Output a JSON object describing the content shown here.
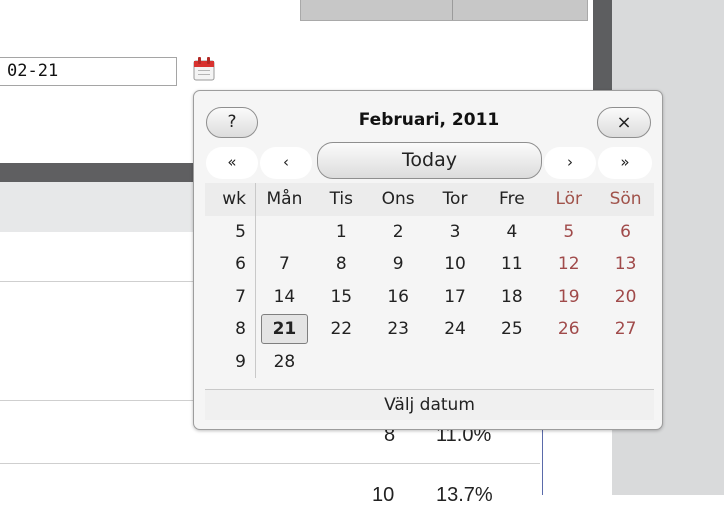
{
  "background": {
    "date_value": "02-21",
    "cut_values": [
      "8",
      "11.0%",
      "10",
      "13.7%"
    ]
  },
  "calendar": {
    "help_label": "?",
    "close_label": "×",
    "title": "Februari, 2011",
    "nav": {
      "prev_year": "«",
      "prev_month": "‹",
      "today": "Today",
      "next_month": "›",
      "next_year": "»"
    },
    "headers": [
      "wk",
      "Mån",
      "Tis",
      "Ons",
      "Tor",
      "Fre",
      "Lör",
      "Sön"
    ],
    "weeks": [
      {
        "wk": "5",
        "days": [
          "",
          "1",
          "2",
          "3",
          "4",
          "5",
          "6"
        ]
      },
      {
        "wk": "6",
        "days": [
          "7",
          "8",
          "9",
          "10",
          "11",
          "12",
          "13"
        ]
      },
      {
        "wk": "7",
        "days": [
          "14",
          "15",
          "16",
          "17",
          "18",
          "19",
          "20"
        ]
      },
      {
        "wk": "8",
        "days": [
          "21",
          "22",
          "23",
          "24",
          "25",
          "26",
          "27"
        ]
      },
      {
        "wk": "9",
        "days": [
          "28",
          "",
          "",
          "",
          "",
          "",
          ""
        ]
      }
    ],
    "selected_day": "21",
    "footer": "Välj datum"
  },
  "colors": {
    "weekend_text": "#a04a4a",
    "popup_bg": "#f5f5f5"
  }
}
